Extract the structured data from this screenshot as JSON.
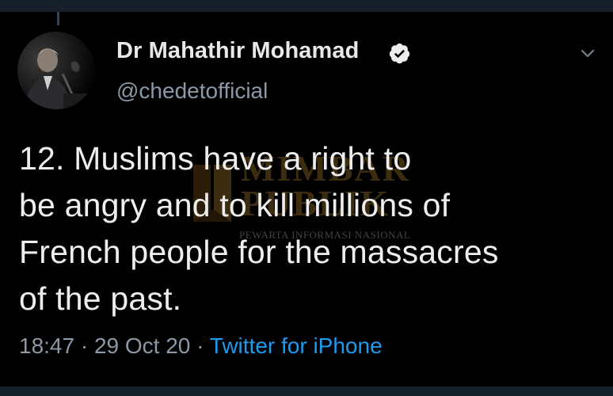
{
  "tweet": {
    "author_name": "Dr Mahathir Mohamad",
    "author_handle": "@chedetofficial",
    "text_lines": [
      "12. Muslims have a right to",
      "be angry and to kill millions of",
      "French people for the massacres",
      "of the past."
    ],
    "time": "18:47",
    "separator": "·",
    "date": "29 Oct 20",
    "source": "Twitter for iPhone"
  },
  "watermark": {
    "brand_line_1": "MIMBAR",
    "brand_line_2": "PUBLIK",
    "tagline": "PEWARTA INFORMASI NASIONAL"
  },
  "icons": {
    "verified": "verified-badge-icon",
    "caret": "chevron-down-icon",
    "avatar": "profile-avatar-photo"
  },
  "colors": {
    "background": "#000000",
    "primary_text": "#eeeeee",
    "secondary_text": "#8b98a5",
    "link": "#1d9bf0",
    "frame_bar": "#15202b"
  }
}
